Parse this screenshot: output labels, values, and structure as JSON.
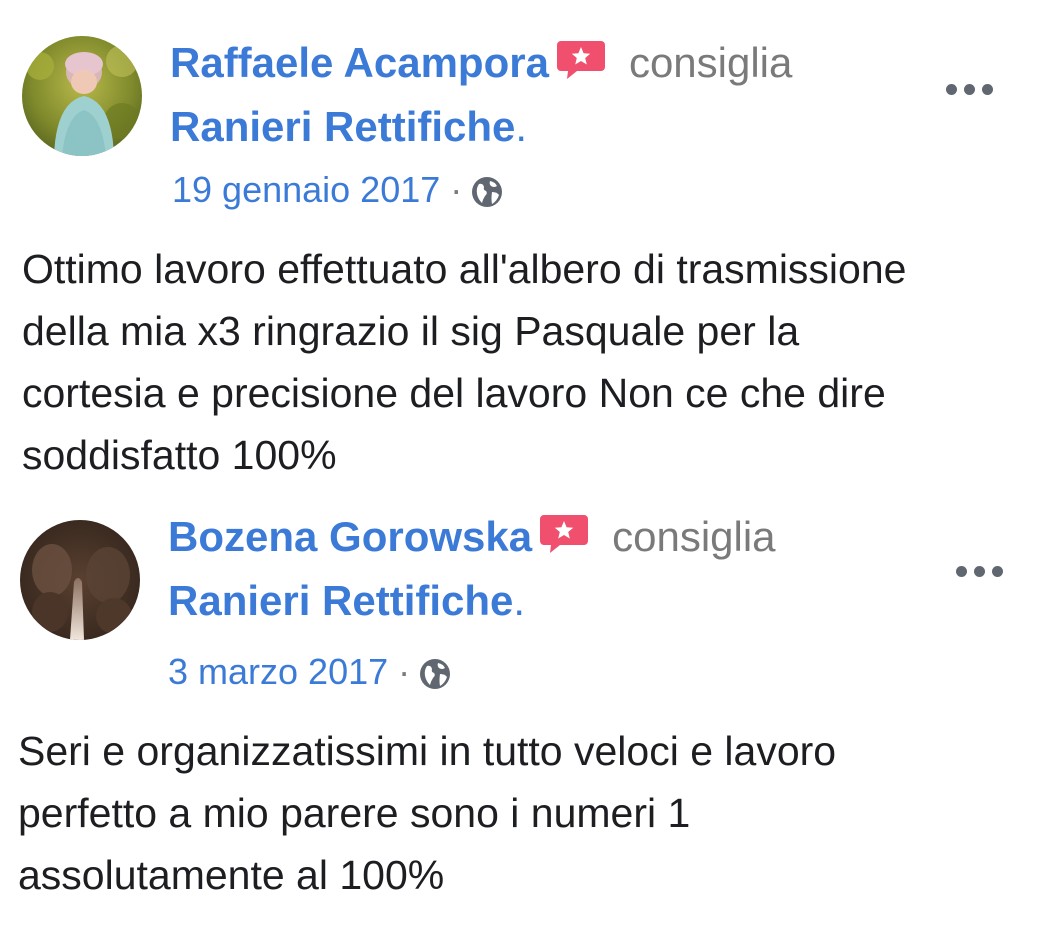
{
  "posts": [
    {
      "author": "Raffaele Acampora",
      "verb": "consiglia",
      "page": "Ranieri Rettifiche",
      "page_suffix": ".",
      "date": "19 gennaio 2017",
      "separator": "·",
      "privacy_icon": "globe-icon",
      "menu_icon": "more-options-icon",
      "text": "Ottimo lavoro effettuato all'albero di trasmissione\ndella mia x3 ringrazio il sig Pasquale per la\ncortesia e precisione del lavoro Non ce che dire\nsoddisfatto 100%"
    },
    {
      "author": "Bozena Gorowska",
      "verb": "consiglia",
      "page": "Ranieri Rettifiche",
      "page_suffix": ".",
      "date": "3 marzo 2017",
      "separator": "·",
      "privacy_icon": "globe-icon",
      "menu_icon": "more-options-icon",
      "text": "Seri e organizzatissimi in tutto veloci e lavoro\nperfetto a mio parere sono i numeri 1\nassolutamente al 100%"
    }
  ],
  "colors": {
    "link": "#3b7ad6",
    "muted": "#7a7a7a",
    "text": "#1c1e21",
    "recommend_badge": "#f0506e"
  }
}
